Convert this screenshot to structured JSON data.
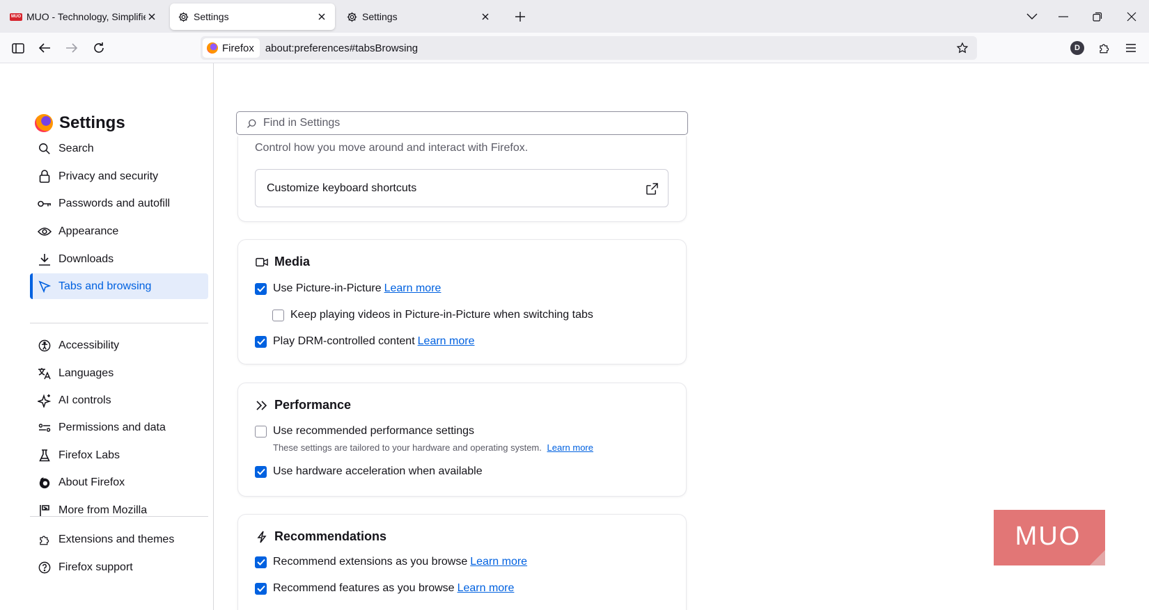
{
  "tabs": [
    {
      "title": "MUO - Technology, Simplified.",
      "icon": "muo-favicon",
      "active": false
    },
    {
      "title": "Settings",
      "icon": "gear-icon",
      "active": true
    },
    {
      "title": "Settings",
      "icon": "gear-icon",
      "active": false
    }
  ],
  "favicon_text": "MUO",
  "urlbar": {
    "identity_label": "Firefox",
    "url": "about:preferences#tabsBrowsing"
  },
  "profile_initial": "D",
  "sidebar": {
    "title": "Settings",
    "items": [
      {
        "label": "Search",
        "icon": "search-icon"
      },
      {
        "label": "Privacy and security",
        "icon": "lock-icon"
      },
      {
        "label": "Passwords and autofill",
        "icon": "key-icon"
      },
      {
        "label": "Appearance",
        "icon": "eye-icon"
      },
      {
        "label": "Downloads",
        "icon": "download-icon"
      },
      {
        "label": "Tabs and browsing",
        "icon": "cursor-icon",
        "selected": true
      },
      {
        "label": "Accessibility",
        "icon": "accessibility-icon"
      },
      {
        "label": "Languages",
        "icon": "translate-icon"
      },
      {
        "label": "AI controls",
        "icon": "sparkle-icon"
      },
      {
        "label": "Permissions and data",
        "icon": "permissions-icon"
      },
      {
        "label": "Firefox Labs",
        "icon": "flask-icon"
      },
      {
        "label": "About Firefox",
        "icon": "firefox-icon"
      },
      {
        "label": "More from Mozilla",
        "icon": "mozilla-icon"
      },
      {
        "label": "Extensions and themes",
        "icon": "puzzle-icon"
      },
      {
        "label": "Firefox support",
        "icon": "help-icon"
      }
    ]
  },
  "search": {
    "placeholder": "Find in Settings"
  },
  "browsing_card": {
    "description": "Control how you move around and interact with Firefox.",
    "shortcuts_button": "Customize keyboard shortcuts"
  },
  "media": {
    "title": "Media",
    "pip": {
      "label": "Use Picture-in-Picture",
      "checked": true,
      "link": "Learn more"
    },
    "keep_playing": {
      "label": "Keep playing videos in Picture-in-Picture when switching tabs",
      "checked": false
    },
    "drm": {
      "label": "Play DRM-controlled content",
      "checked": true,
      "link": "Learn more"
    }
  },
  "performance": {
    "title": "Performance",
    "recommended": {
      "label": "Use recommended performance settings",
      "checked": false
    },
    "recommended_note": "These settings are tailored to your hardware and operating system.",
    "recommended_link": "Learn more",
    "hw_accel": {
      "label": "Use hardware acceleration when available",
      "checked": true
    }
  },
  "recommendations": {
    "title": "Recommendations",
    "extensions": {
      "label": "Recommend extensions as you browse",
      "checked": true,
      "link": "Learn more"
    },
    "features": {
      "label": "Recommend features as you browse",
      "checked": true,
      "link": "Learn more"
    }
  },
  "watermark": {
    "text": "MUO",
    "color": "#e06a6a"
  },
  "colors": {
    "accent": "#0061e0",
    "selected_bg": "#e4ecfb",
    "tabstrip_bg": "#ebebef"
  }
}
